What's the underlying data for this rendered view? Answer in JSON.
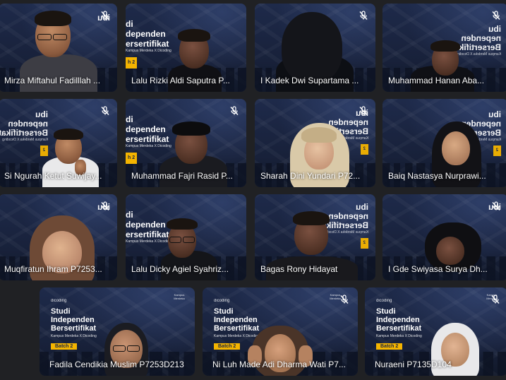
{
  "meeting": {
    "participants": [
      {
        "name": "Mirza Miftahul Fadilllah ...",
        "muted": true
      },
      {
        "name": "Lalu Rizki Aldi Saputra P...",
        "muted": false
      },
      {
        "name": "I Kadek Dwi Supartama ...",
        "muted": true
      },
      {
        "name": "Muhammad Hanan Aba...",
        "muted": true
      },
      {
        "name": "Si Ngurah Ketut Suwijay...",
        "muted": true
      },
      {
        "name": "Muhammad Fajri Rasid P...",
        "muted": true
      },
      {
        "name": "Sharah Dini Yundari P72...",
        "muted": true
      },
      {
        "name": "Baiq Nastasya Nurprawi...",
        "muted": true
      },
      {
        "name": "Muqfiratun Ihram P7253...",
        "muted": true
      },
      {
        "name": "Lalu Dicky Agiel Syahriz...",
        "muted": true
      },
      {
        "name": "Bagas Rony Hidayat",
        "muted": false
      },
      {
        "name": "I Gde Swiyasa Surya Dh...",
        "muted": true
      },
      {
        "name": "Fadila Cendikia Muslim P7253D213",
        "muted": false
      },
      {
        "name": "Ni Luh Made Adi Dharma Wati P7...",
        "muted": true
      },
      {
        "name": "Nuraeni P7135D104",
        "muted": true
      }
    ]
  },
  "background": {
    "logo": "dicoding",
    "title_line1": "Studi",
    "title_line2": "Independen",
    "title_line3": "Bersertifikat",
    "subtitle": "Kampus Merdeka X Dicoding",
    "batch": "Batch 2",
    "kampus_badge": "Kampus Merdeka",
    "mirror_line1": "ibu",
    "mirror_line2": "nependen",
    "mirror_line3": "Bersertifikat",
    "mirror_sub": "Kampus Merdeka X Dicoding",
    "mirror_batch": "2",
    "left_line1": "di",
    "left_line2": "dependen",
    "left_line3": "ersertifikat",
    "left_sub": "Kampus Merdeka X Dicoding",
    "left_batch": "h 2"
  },
  "icons": {
    "mic_muted": "mic-off-icon"
  },
  "colors": {
    "app_bg": "#202124",
    "tile_bg": "#1b2440",
    "batch_yellow": "#f4b400",
    "name_text": "#ffffff"
  }
}
